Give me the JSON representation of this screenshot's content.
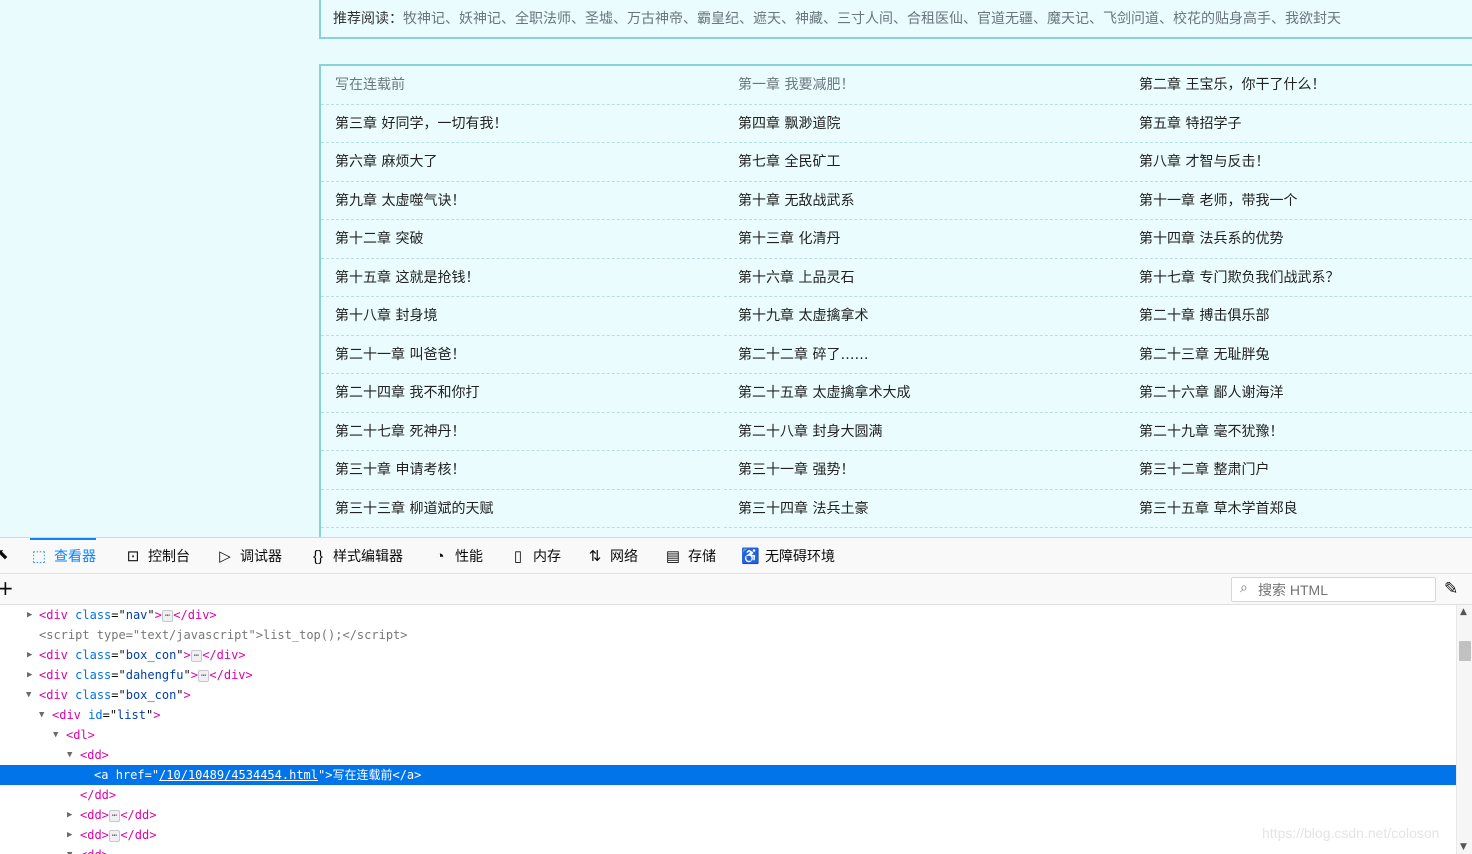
{
  "page": {
    "recommend_label": "推荐阅读：",
    "recommend_items": [
      "牧神记",
      "妖神记",
      "全职法师",
      "圣墟",
      "万古神帝",
      "霸皇纪",
      "遮天",
      "神藏",
      "三寸人间",
      "合租医仙",
      "官道无疆",
      "魔天记",
      "飞剑问道",
      "校花的贴身高手",
      "我欲封天"
    ],
    "recommend_sep": "、",
    "chapters": [
      [
        "写在连载前",
        "第一章 我要减肥！",
        "第二章 王宝乐，你干了什么！"
      ],
      [
        "第三章 好同学，一切有我！",
        "第四章 飘渺道院",
        "第五章 特招学子"
      ],
      [
        "第六章 麻烦大了",
        "第七章 全民矿工",
        "第八章 才智与反击！"
      ],
      [
        "第九章 太虚噬气诀！",
        "第十章 无敌战武系",
        "第十一章 老师，带我一个"
      ],
      [
        "第十二章 突破",
        "第十三章 化清丹",
        "第十四章 法兵系的优势"
      ],
      [
        "第十五章 这就是抢钱！",
        "第十六章 上品灵石",
        "第十七章 专门欺负我们战武系？"
      ],
      [
        "第十八章 封身境",
        "第十九章 太虚擒拿术",
        "第二十章 搏击俱乐部"
      ],
      [
        "第二十一章 叫爸爸！",
        "第二十二章 碎了……",
        "第二十三章 无耻胖兔"
      ],
      [
        "第二十四章 我不和你打",
        "第二十五章 太虚擒拿术大成",
        "第二十六章 鄙人谢海洋"
      ],
      [
        "第二十七章 死神丹！",
        "第二十八章 封身大圆满",
        "第二十九章 毫不犹豫！"
      ],
      [
        "第三十章 申请考核！",
        "第三十一章 强势！",
        "第三十二章 整肃门户"
      ],
      [
        "第三十三章 柳道斌的天赋",
        "第三十四章 法兵土豪",
        "第三十五章 草木学首郑良"
      ]
    ]
  },
  "devtools": {
    "tabs": [
      {
        "label": "查看器",
        "icon": "inspector-icon",
        "active": true
      },
      {
        "label": "控制台",
        "icon": "console-icon"
      },
      {
        "label": "调试器",
        "icon": "debugger-icon"
      },
      {
        "label": "样式编辑器",
        "icon": "style-editor-icon"
      },
      {
        "label": "性能",
        "icon": "performance-icon"
      },
      {
        "label": "内存",
        "icon": "memory-icon"
      },
      {
        "label": "网络",
        "icon": "network-icon"
      },
      {
        "label": "存储",
        "icon": "storage-icon"
      },
      {
        "label": "无障碍环境",
        "icon": "accessibility-icon"
      }
    ],
    "search_placeholder": "搜索 HTML",
    "markup": {
      "l1_attr": "class",
      "l1_val": "nav",
      "l2_attr": "type",
      "l2_val": "text/javascript",
      "l2_text": "list_top();",
      "l3_attr": "class",
      "l3_val": "box_con",
      "l4_attr": "class",
      "l4_val": "dahengfu",
      "l5_attr": "class",
      "l5_val": "box_con",
      "l6_attr": "id",
      "l6_val": "list",
      "l9_attr": "href",
      "l9_val": "/10/10489/4534454.html",
      "l9_text": "写在连载前"
    }
  },
  "watermark": "https://blog.csdn.net/coloson"
}
